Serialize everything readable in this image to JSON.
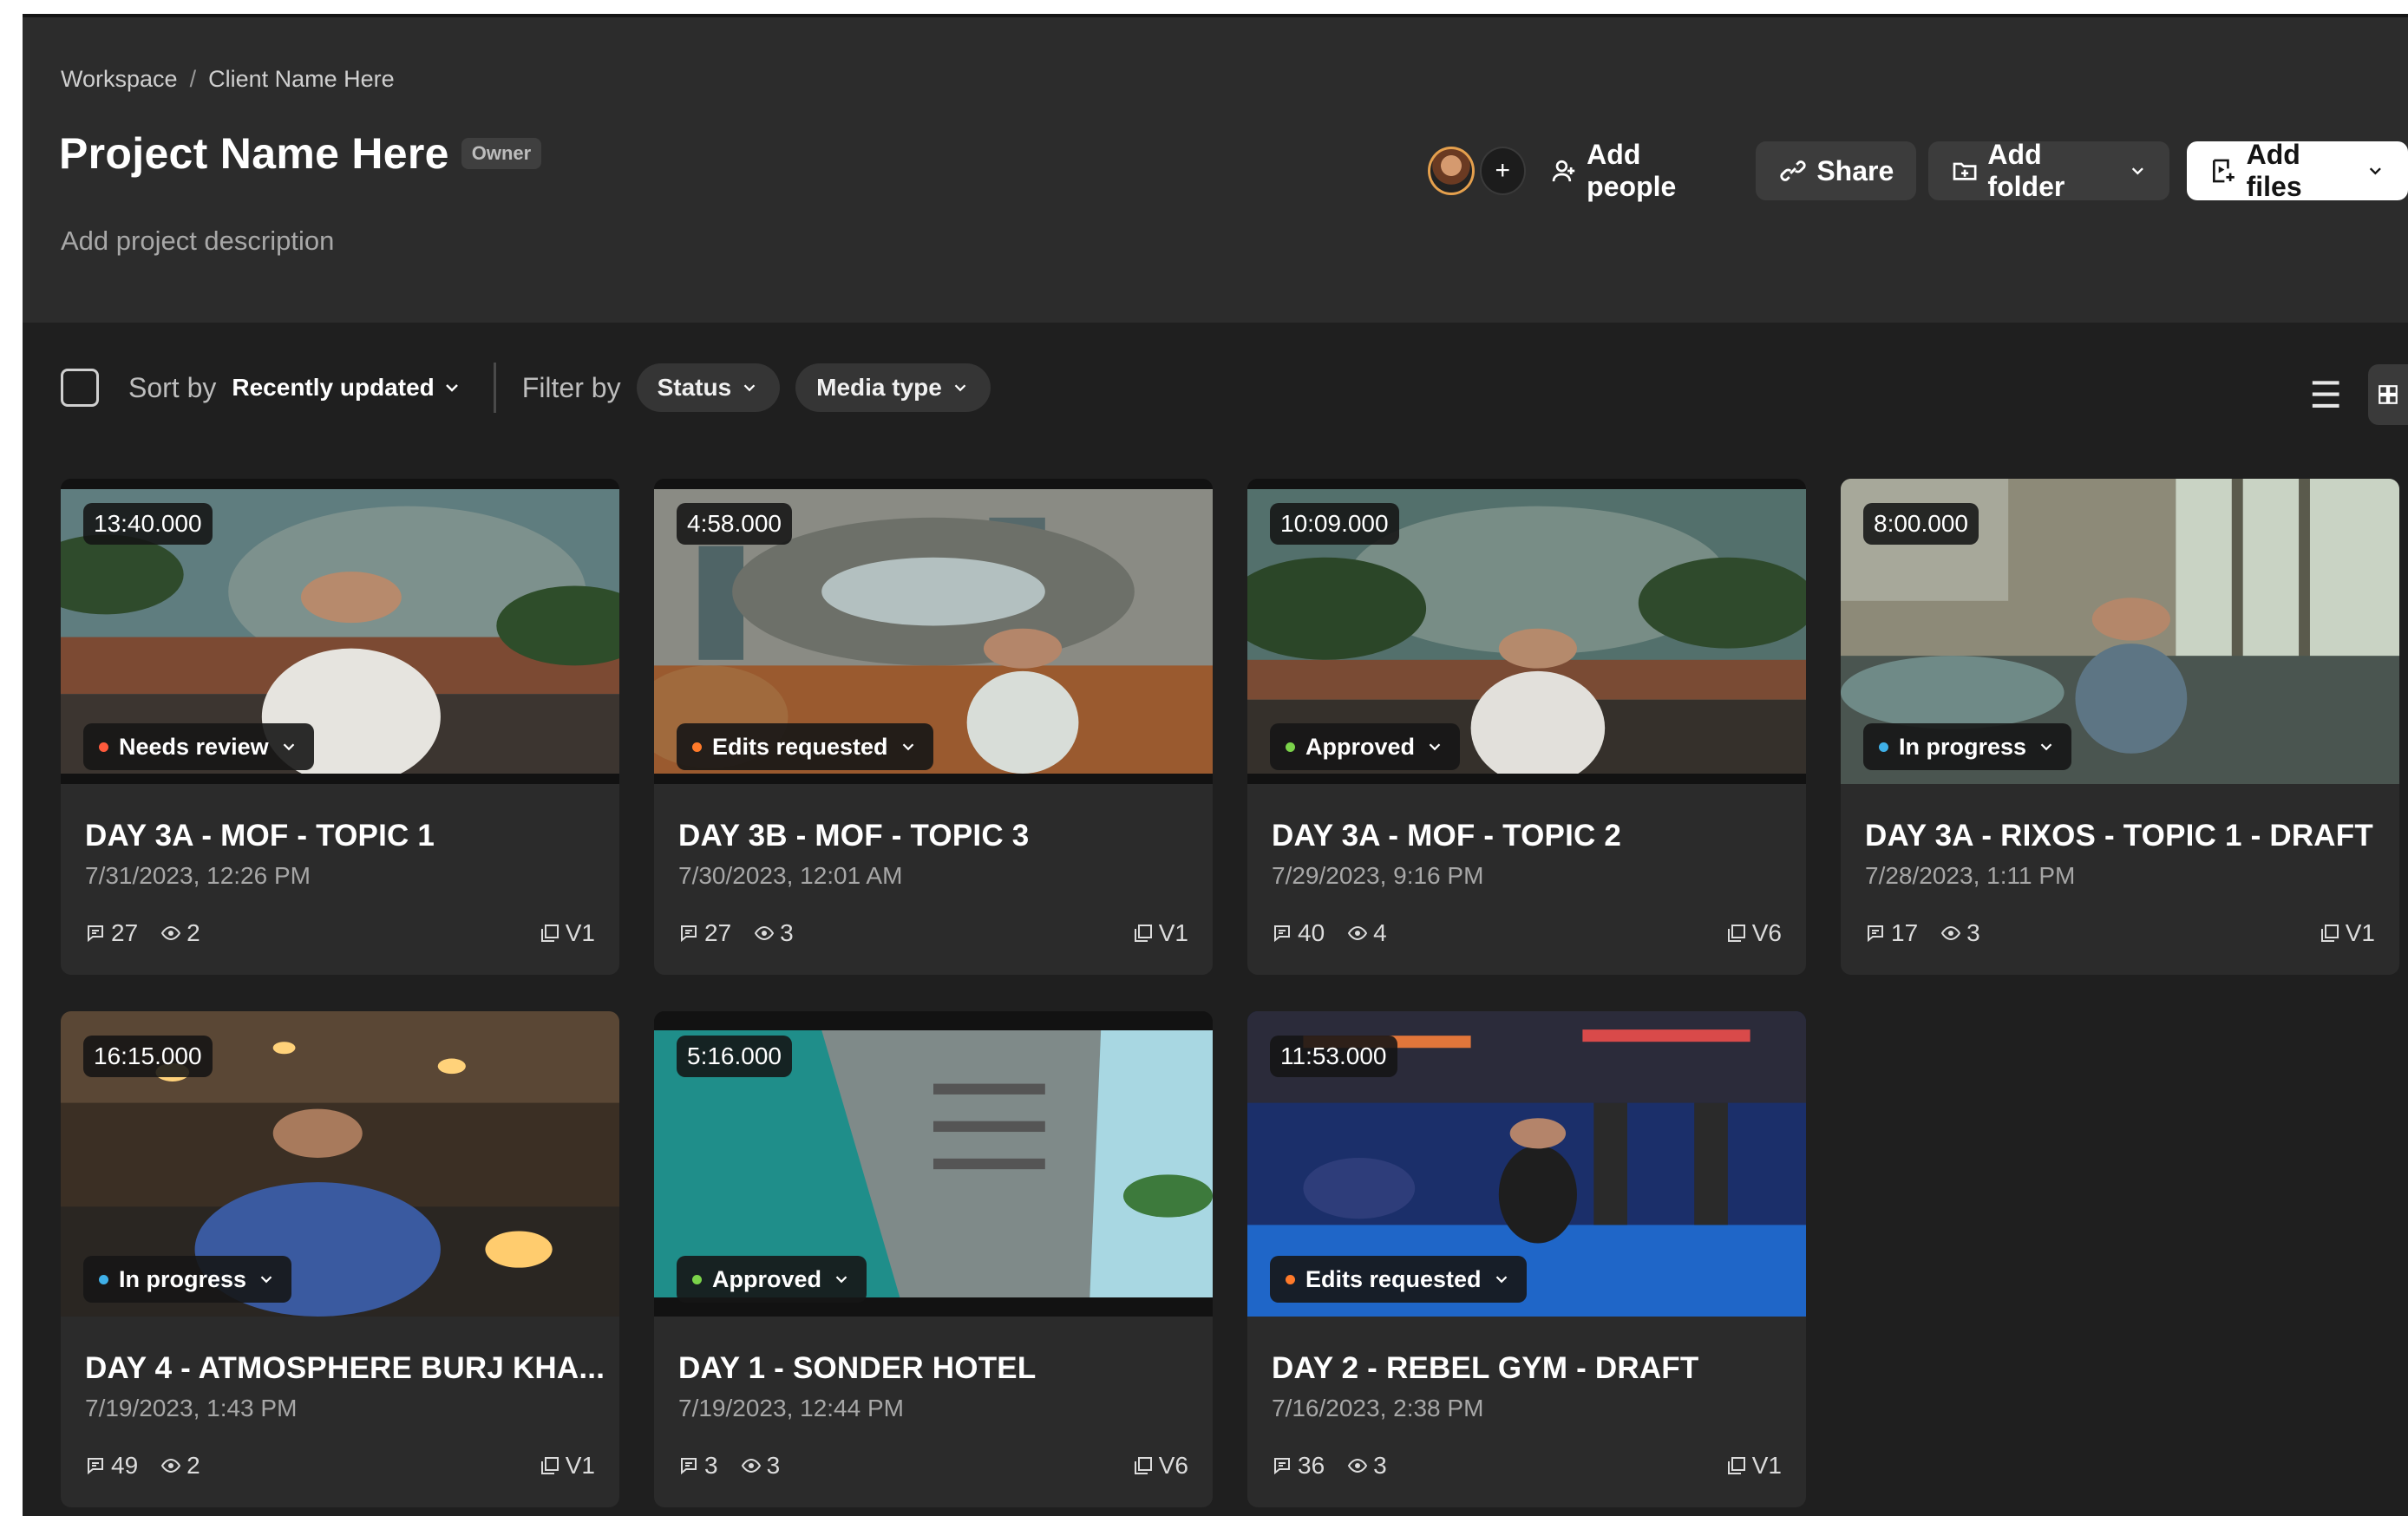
{
  "breadcrumb": {
    "workspace": "Workspace",
    "separator": "/",
    "client": "Client Name Here"
  },
  "project": {
    "title": "Project Name Here",
    "role_badge": "Owner",
    "description_placeholder": "Add project description"
  },
  "actions": {
    "invite_plus": "+",
    "add_people": "Add people",
    "share": "Share",
    "add_folder": "Add folder",
    "add_files": "Add files"
  },
  "toolbar": {
    "sort_label": "Sort by",
    "sort_value": "Recently updated",
    "filter_label": "Filter by",
    "status_filter": "Status",
    "media_type_filter": "Media type"
  },
  "colors": {
    "needs_review": "#ff5a3c",
    "edits_requested": "#ff7a2a",
    "approved": "#7bd34a",
    "in_progress": "#3fb0e8"
  },
  "assets": [
    {
      "duration": "13:40.000",
      "status": "Needs review",
      "status_key": "needs_review",
      "title": "DAY 3A - MOF - TOPIC 1",
      "date": "7/31/2023, 12:26 PM",
      "comments": "27",
      "views": "2",
      "version": "V1"
    },
    {
      "duration": "4:58.000",
      "status": "Edits requested",
      "status_key": "edits_requested",
      "title": "DAY 3B - MOF - TOPIC 3",
      "date": "7/30/2023, 12:01 AM",
      "comments": "27",
      "views": "3",
      "version": "V1"
    },
    {
      "duration": "10:09.000",
      "status": "Approved",
      "status_key": "approved",
      "title": "DAY 3A - MOF - TOPIC 2",
      "date": "7/29/2023, 9:16 PM",
      "comments": "40",
      "views": "4",
      "version": "V6"
    },
    {
      "duration": "8:00.000",
      "status": "In progress",
      "status_key": "in_progress",
      "title": "DAY 3A - RIXOS - TOPIC 1 - DRAFT",
      "date": "7/28/2023, 1:11 PM",
      "comments": "17",
      "views": "3",
      "version": "V1"
    },
    {
      "duration": "16:15.000",
      "status": "In progress",
      "status_key": "in_progress",
      "title": "DAY 4 - ATMOSPHERE BURJ KHA...",
      "date": "7/19/2023, 1:43 PM",
      "comments": "49",
      "views": "2",
      "version": "V1"
    },
    {
      "duration": "5:16.000",
      "status": "Approved",
      "status_key": "approved",
      "title": "DAY 1 - SONDER HOTEL",
      "date": "7/19/2023, 12:44 PM",
      "comments": "3",
      "views": "3",
      "version": "V6"
    },
    {
      "duration": "11:53.000",
      "status": "Edits requested",
      "status_key": "edits_requested",
      "title": "DAY 2 - REBEL GYM - DRAFT",
      "date": "7/16/2023, 2:38 PM",
      "comments": "36",
      "views": "3",
      "version": "V1"
    }
  ]
}
